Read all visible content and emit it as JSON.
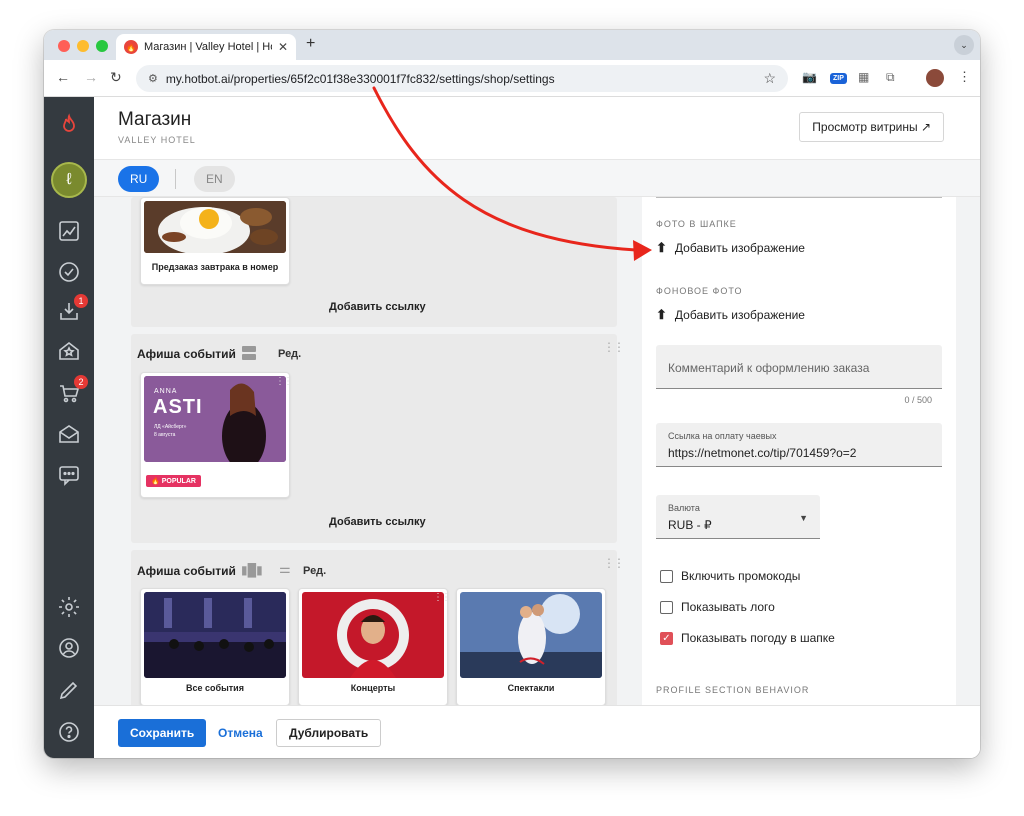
{
  "browser": {
    "tab_title": "Магазин | Valley Hotel | Hotb",
    "url": "my.hotbot.ai/properties/65f2c01f38e330001f7fc832/settings/shop/settings",
    "zip_label": "ZIP"
  },
  "rail": {
    "badges": [
      "1",
      "2"
    ]
  },
  "header": {
    "title": "Магазин",
    "subtitle": "VALLEY HOTEL",
    "preview_label": "Просмотр витрины ↗"
  },
  "languages": [
    "RU",
    "EN"
  ],
  "sections": {
    "top": {
      "card_label": "Предзаказ завтрака в номер",
      "add_link": "Добавить ссылку"
    },
    "events1": {
      "title": "Афиша событий",
      "edit": "Ред.",
      "badge": "POPULAR",
      "poster": {
        "name": "ANNA",
        "title": "ASTI",
        "venue": "ЛД «Айсберг»",
        "date": "8 августа"
      },
      "add_link": "Добавить ссылку"
    },
    "events2": {
      "title": "Афиша событий",
      "edit": "Ред.",
      "cards": [
        "Все события",
        "Концерты",
        "Спектакли"
      ]
    }
  },
  "panel": {
    "header_photo_label": "ФОТО В ШАПКЕ",
    "add_image": "Добавить изображение",
    "bg_photo_label": "ФОНОВОЕ ФОТО",
    "comment_placeholder": "Комментарий к оформлению заказа",
    "comment_counter": "0 / 500",
    "tips_label": "Ссылка на оплату чаевых",
    "tips_value": "https://netmonet.co/tip/701459?o=2",
    "currency_label": "Валюта",
    "currency_value": "RUB - ₽",
    "checkboxes": [
      {
        "label": "Включить промокоды",
        "checked": false
      },
      {
        "label": "Показывать лого",
        "checked": false
      },
      {
        "label": "Показывать погоду в шапке",
        "checked": true
      }
    ],
    "profile_behavior_label": "PROFILE SECTION BEHAVIOR"
  },
  "footer": {
    "save": "Сохранить",
    "cancel": "Отмена",
    "duplicate": "Дублировать"
  },
  "colors": {
    "accent": "#1a73e8",
    "rail": "#343a40",
    "check_on": "#e05058",
    "arrow": "#e8261c"
  }
}
